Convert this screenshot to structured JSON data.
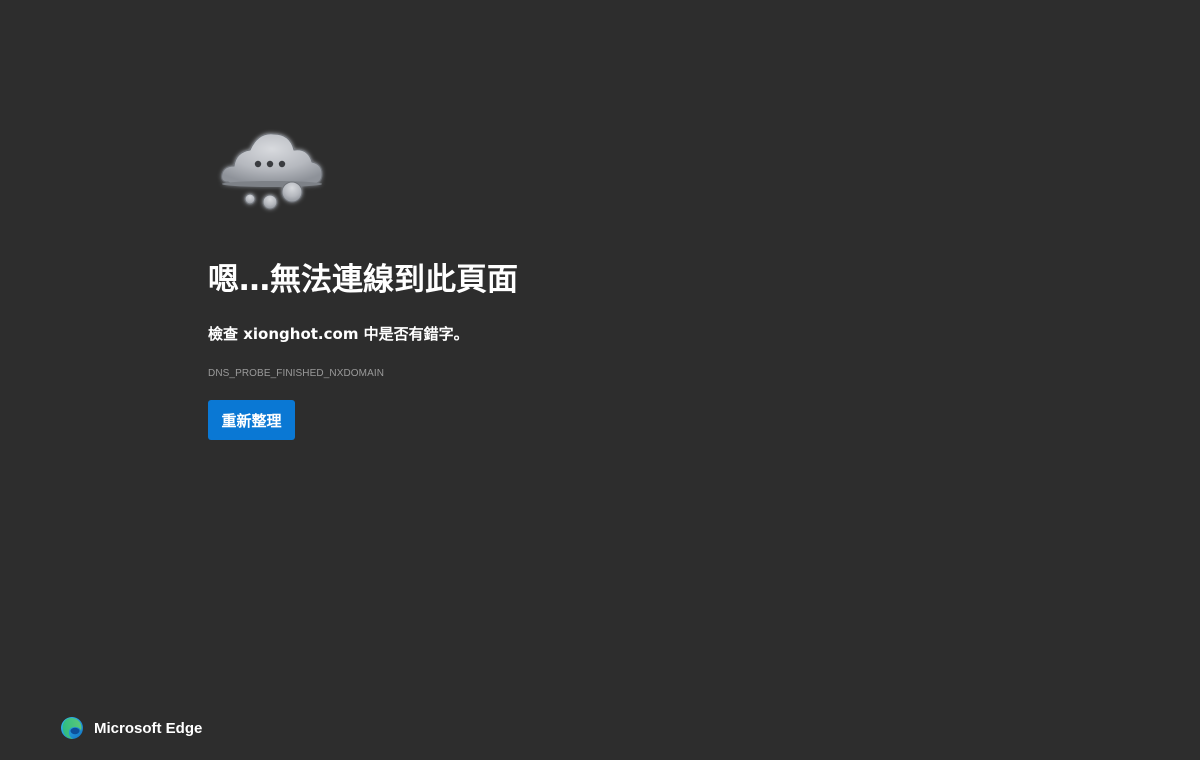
{
  "error": {
    "illustration_icon": "cloud-thinking-icon",
    "title": "嗯…無法連線到此頁面",
    "hint_prefix": "檢查 ",
    "hint_domain": "xionghot.com",
    "hint_suffix": " 中是否有錯字。",
    "code": "DNS_PROBE_FINISHED_NXDOMAIN",
    "refresh_label": "重新整理"
  },
  "brand": {
    "logo_icon": "edge-logo-icon",
    "name": "Microsoft Edge"
  },
  "colors": {
    "background": "#2d2d2d",
    "accent": "#0a78d4",
    "text": "#ffffff",
    "muted": "#9a9a9a"
  }
}
